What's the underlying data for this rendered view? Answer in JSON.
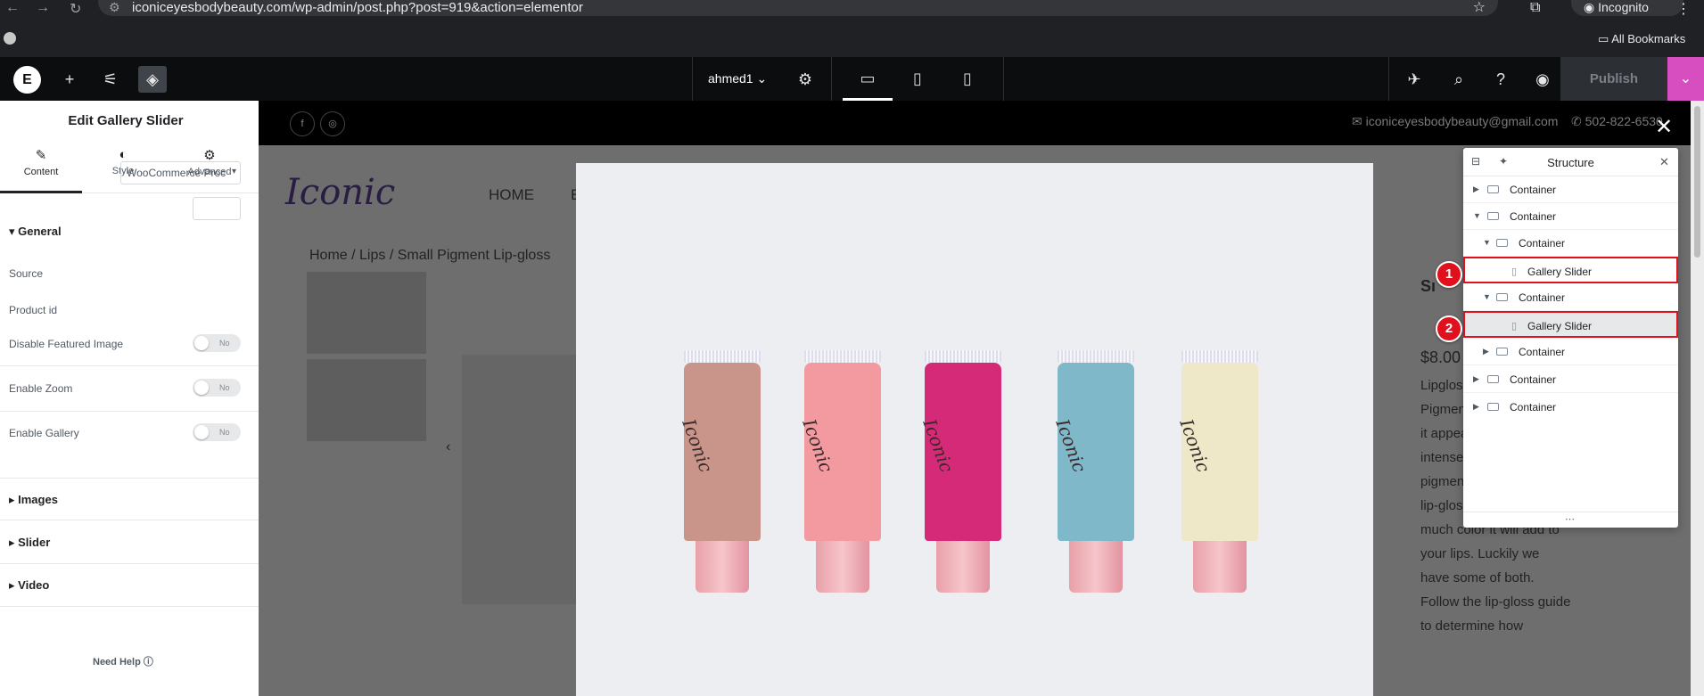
{
  "browser": {
    "url": "iconiceyesbodybeauty.com/wp-admin/post.php?post=919&action=elementor",
    "profile": "Incognito",
    "bookmarks_label": "All Bookmarks"
  },
  "topbar": {
    "document_name": "ahmed1",
    "publish_label": "Publish",
    "accent_color": "#d74ec1"
  },
  "panel": {
    "title": "Edit Gallery Slider",
    "tabs": [
      {
        "label": "Content",
        "icon": "pencil-icon"
      },
      {
        "label": "Style",
        "icon": "contrast-icon"
      },
      {
        "label": "Advanced",
        "icon": "gear-icon"
      }
    ],
    "general_section": "General",
    "source_label": "Source",
    "source_value": "WooCommerce Proc",
    "product_id_label": "Product id",
    "disable_featured_label": "Disable Featured Image",
    "enable_zoom_label": "Enable Zoom",
    "enable_gallery_label": "Enable Gallery",
    "switch_off_text": "No",
    "sections": [
      "Images",
      "Slider",
      "Video"
    ],
    "need_help": "Need Help"
  },
  "site": {
    "email": "iconiceyesbodybeauty@gmail.com",
    "phone": "502-822-6530",
    "logo_text": "Iconic",
    "nav_home": "HOME",
    "nav_second": "E",
    "breadcrumbs": "Home / Lips / Small Pigment Lip-gloss",
    "product_title": "Sı",
    "price": "$8.00",
    "description": "Lipglos used to tint, to Pigmen gloss th level of it appears vibrant and intense on the lips. The pigmentation level of a lip-gloss determines how much color it will add to your lips. Luckily we have some of both.  Follow the lip-gloss guide to determine how"
  },
  "lightbox": {
    "brand_on_tubes": "Iconic",
    "tube_colors": [
      "#c9958a",
      "#f29aa0",
      "#d42a78",
      "#7fb8c8",
      "#eee7c8"
    ]
  },
  "structure": {
    "title": "Structure",
    "rows": [
      {
        "label": "Container",
        "depth": 0,
        "expanded": false,
        "type": "container"
      },
      {
        "label": "Container",
        "depth": 0,
        "expanded": true,
        "type": "container"
      },
      {
        "label": "Container",
        "depth": 1,
        "expanded": true,
        "type": "container"
      },
      {
        "label": "Gallery Slider",
        "depth": 2,
        "type": "widget",
        "marker": "1"
      },
      {
        "label": "Container",
        "depth": 1,
        "expanded": true,
        "type": "container"
      },
      {
        "label": "Gallery Slider",
        "depth": 2,
        "type": "widget",
        "marker": "2",
        "selected": true
      },
      {
        "label": "Container",
        "depth": 1,
        "expanded": false,
        "type": "container"
      },
      {
        "label": "Container",
        "depth": 0,
        "expanded": false,
        "type": "container"
      },
      {
        "label": "Container",
        "depth": 0,
        "expanded": false,
        "type": "container"
      }
    ],
    "highlight_color": "#e0101c"
  }
}
